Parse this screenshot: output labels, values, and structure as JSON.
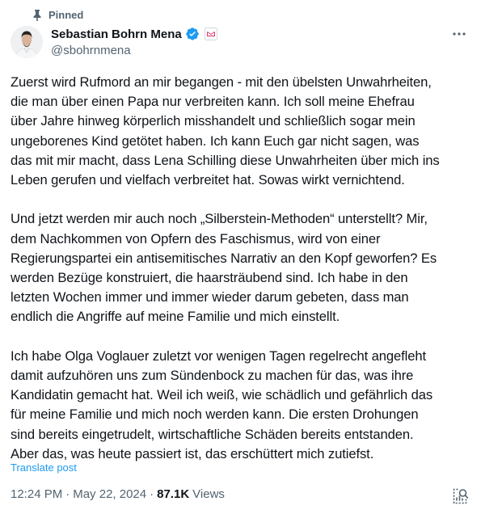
{
  "pinned_label": "Pinned",
  "author": {
    "display_name": "Sebastian Bohrn Mena",
    "handle": "@sbohrnmena",
    "verified": true
  },
  "post": {
    "paragraphs": [
      [
        "Zuerst wird Rufmord an mir begangen - mit den übelsten Unwahrheiten,",
        "die man über einen Papa nur verbreiten kann. Ich soll meine Ehefrau",
        "über Jahre hinweg körperlich misshandelt und schließlich sogar mein",
        "ungeborenes Kind getötet haben. Ich kann Euch gar nicht sagen, was",
        "das mit mir macht, dass Lena Schilling diese Unwahrheiten über mich ins",
        "Leben gerufen und vielfach verbreitet hat. Sowas wirkt vernichtend."
      ],
      [
        "Und jetzt werden mir auch noch „Silberstein-Methoden“ unterstellt? Mir,",
        "dem Nachkommen von Opfern des Faschismus, wird von einer",
        "Regierungspartei ein antisemitisches Narrativ an den Kopf geworfen? Es",
        "werden Bezüge konstruiert, die haarsträubend sind. Ich habe in den",
        "letzten Wochen immer und immer wieder darum gebeten, dass man",
        "endlich die Angriffe auf meine Familie und mich einstellt."
      ],
      [
        "Ich habe Olga Voglauer zuletzt vor wenigen Tagen regelrecht angefleht",
        "damit aufzuhören uns zum Sündenbock zu machen für das, was ihre",
        "Kandidatin gemacht hat. Weil ich weiß, wie schädlich und gefährlich das",
        "für meine Familie und mich noch werden kann. Die ersten Drohungen",
        "sind bereits eingetrudelt, wirtschaftliche Schäden bereits entstanden.",
        "Aber das, was heute passiert ist, das erschüttert mich zutiefst."
      ]
    ],
    "translate_label": "Translate post",
    "time": "12:24 PM",
    "separator": "·",
    "date": "May 22, 2024",
    "views_count": "87.1K",
    "views_label": "Views"
  },
  "colors": {
    "text_primary": "#0f1419",
    "text_secondary": "#536471",
    "accent": "#1d9bf0"
  },
  "icons": {
    "pin": "pin-icon",
    "verified": "verified-badge-icon",
    "affiliation": "affiliation-badge-icon",
    "more": "more-options-icon",
    "analytics": "analytics-icon"
  }
}
